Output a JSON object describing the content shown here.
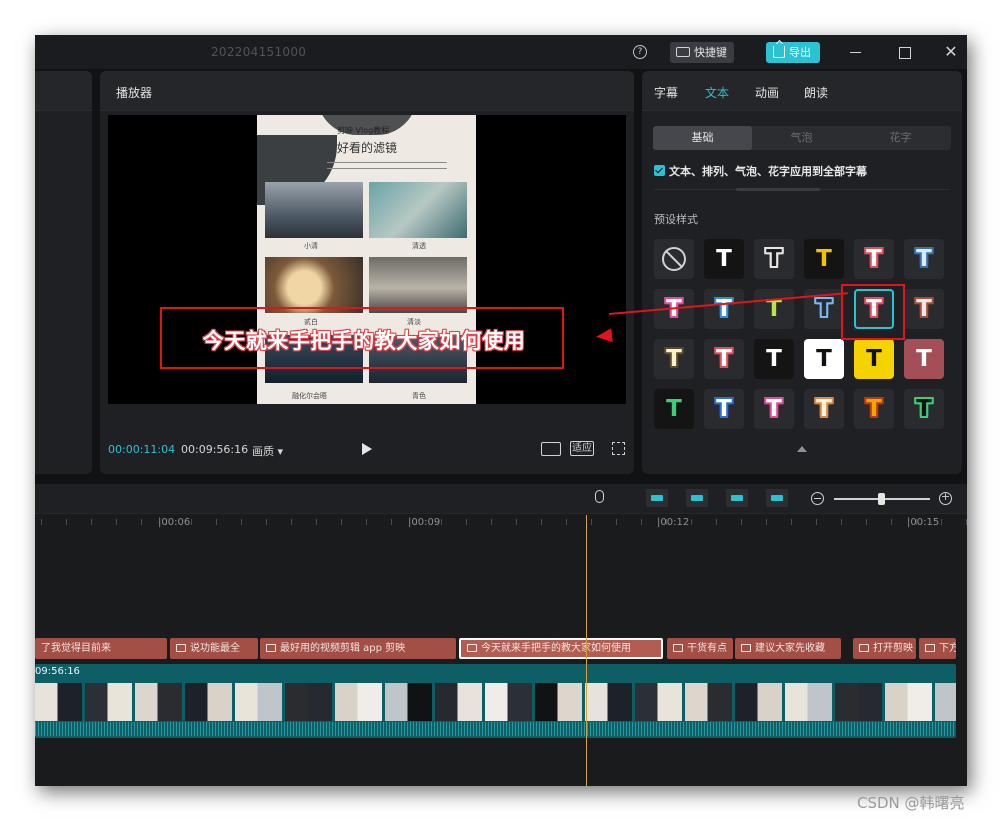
{
  "titlebar": {
    "project_name": "202204151000",
    "help": "?",
    "shortcut_label": "快捷键",
    "export_label": "导出",
    "close": "✕"
  },
  "player": {
    "title": "播放器",
    "current_time": "00:00:11:04",
    "duration": "00:09:56:16",
    "quality_label": "画质 ▾",
    "fit_label": "适应",
    "poster": {
      "line1": "剪映 Vlog教程",
      "line2": "好看的滤镜",
      "captions": [
        "小清",
        "清透",
        "贰白",
        "清淡",
        "融化尔会晤",
        "青色"
      ]
    }
  },
  "annotation": {
    "subtitle_text": "今天就来手把手的教大家如何使用"
  },
  "right_panel": {
    "tabs": [
      "字幕",
      "文本",
      "动画",
      "朗读"
    ],
    "active_tab": 1,
    "subtabs": [
      "基础",
      "气泡",
      "花字"
    ],
    "apply_all_label": "文本、排列、气泡、花字应用到全部字幕",
    "preset_title": "预设样式",
    "accent_color": "#29c3d4",
    "presets": [
      {
        "glyph": "",
        "fg": "#cfd2d6",
        "bg": "#2a2b2f",
        "stroke": "",
        "none": true
      },
      {
        "glyph": "T",
        "fg": "#ffffff",
        "bg": "#141414",
        "stroke": "#141414"
      },
      {
        "glyph": "T",
        "fg": "#1b1b1b",
        "bg": "#2a2b2f",
        "stroke": "#e6e6e6"
      },
      {
        "glyph": "T",
        "fg": "#f5c400",
        "bg": "#141414",
        "stroke": "#141414"
      },
      {
        "glyph": "T",
        "fg": "#ffffff",
        "bg": "#2a2b2f",
        "stroke": "#e44b5b"
      },
      {
        "glyph": "T",
        "fg": "#d6ecff",
        "bg": "#2a2b2f",
        "stroke": "#3a6fa8"
      },
      {
        "glyph": "T",
        "fg": "#ffffff",
        "bg": "#2a2b2f",
        "stroke": "#e44b9a"
      },
      {
        "glyph": "T",
        "fg": "#ffffff",
        "bg": "#2a2b2f",
        "stroke": "#2a8fe0"
      },
      {
        "glyph": "T",
        "fg": "#b9e34a",
        "bg": "#2a2b2f",
        "stroke": "#2a2b2f"
      },
      {
        "glyph": "T",
        "fg": "#2a2b2f",
        "bg": "#2a2b2f",
        "stroke": "#7ab6f0"
      },
      {
        "glyph": "T",
        "fg": "#ffffff",
        "bg": "#2a2b2f",
        "stroke": "#e44b5b",
        "selected": true
      },
      {
        "glyph": "T",
        "fg": "#f3e6e0",
        "bg": "#2a2b2f",
        "stroke": "#a24d3a"
      },
      {
        "glyph": "T",
        "fg": "#fff2c8",
        "bg": "#2a2b2f",
        "stroke": "#5a4a2a"
      },
      {
        "glyph": "T",
        "fg": "#ffffff",
        "bg": "#2a2b2f",
        "stroke": "#e44b5b"
      },
      {
        "glyph": "T",
        "fg": "#ffffff",
        "bg": "#141414",
        "stroke": "#141414"
      },
      {
        "glyph": "T",
        "fg": "#111111",
        "bg": "#ffffff",
        "stroke": "#ffffff"
      },
      {
        "glyph": "T",
        "fg": "#111111",
        "bg": "#f5d300",
        "stroke": "#f5d300"
      },
      {
        "glyph": "T",
        "fg": "#ffffff",
        "bg": "#a34f55",
        "stroke": "#a34f55"
      },
      {
        "glyph": "T",
        "fg": "#3ad07a",
        "bg": "#141414",
        "stroke": "#141414"
      },
      {
        "glyph": "T",
        "fg": "#ffffff",
        "bg": "#2a2b2f",
        "stroke": "#2a6fd8"
      },
      {
        "glyph": "T",
        "fg": "#ffffff",
        "bg": "#2a2b2f",
        "stroke": "#e44b9a"
      },
      {
        "glyph": "T",
        "fg": "#fff2dc",
        "bg": "#2a2b2f",
        "stroke": "#d98a4a"
      },
      {
        "glyph": "T",
        "fg": "#f5a300",
        "bg": "#2a2b2f",
        "stroke": "#b83a10"
      },
      {
        "glyph": "T",
        "fg": "#111111",
        "bg": "#2a2b2f",
        "stroke": "#3ad07a"
      }
    ]
  },
  "timeline": {
    "ticks": [
      "00:06",
      "00:09",
      "00:12",
      "00:15"
    ],
    "video_duration": "09:56:16",
    "subtitles": [
      {
        "text": "了我觉得目前来",
        "active": false
      },
      {
        "text": "说功能最全",
        "active": false
      },
      {
        "text": "最好用的视频剪辑 app 剪映",
        "active": false
      },
      {
        "text": "今天就来手把手的教大家如何使用",
        "active": true
      },
      {
        "text": "干货有点",
        "active": false
      },
      {
        "text": "建议大家先收藏",
        "active": false
      },
      {
        "text": "打开剪映",
        "active": false
      },
      {
        "text": "下方",
        "active": false
      }
    ]
  },
  "watermark": "CSDN @韩曙亮"
}
